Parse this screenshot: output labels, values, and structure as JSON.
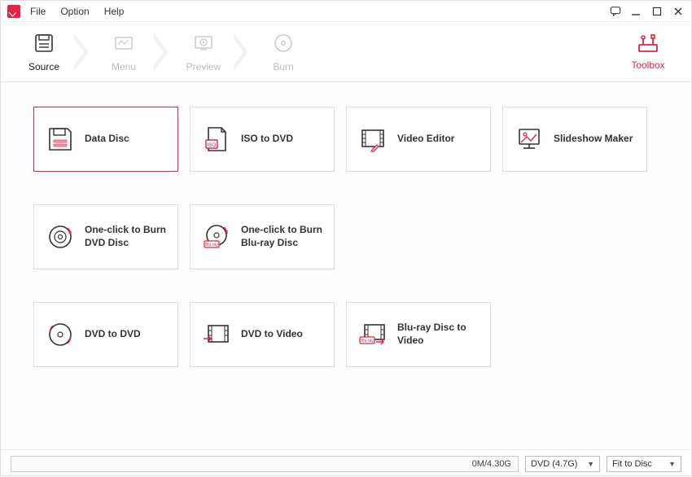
{
  "menu": {
    "file": "File",
    "option": "Option",
    "help": "Help"
  },
  "steps": {
    "source": "Source",
    "menu": "Menu",
    "preview": "Preview",
    "burn": "Burn",
    "toolbox": "Toolbox"
  },
  "cards": {
    "data_disc": "Data Disc",
    "iso_to_dvd": "ISO to DVD",
    "video_editor": "Video Editor",
    "slideshow_maker": "Slideshow Maker",
    "one_click_dvd": "One-click to Burn DVD Disc",
    "one_click_bluray": "One-click to Burn Blu-ray Disc",
    "dvd_to_dvd": "DVD to DVD",
    "dvd_to_video": "DVD to Video",
    "bluray_to_video": "Blu-ray Disc to Video"
  },
  "bottom": {
    "progress": "0M/4.30G",
    "disc_type": "DVD (4.7G)",
    "fit": "Fit to Disc"
  },
  "colors": {
    "accent": "#e52345"
  }
}
